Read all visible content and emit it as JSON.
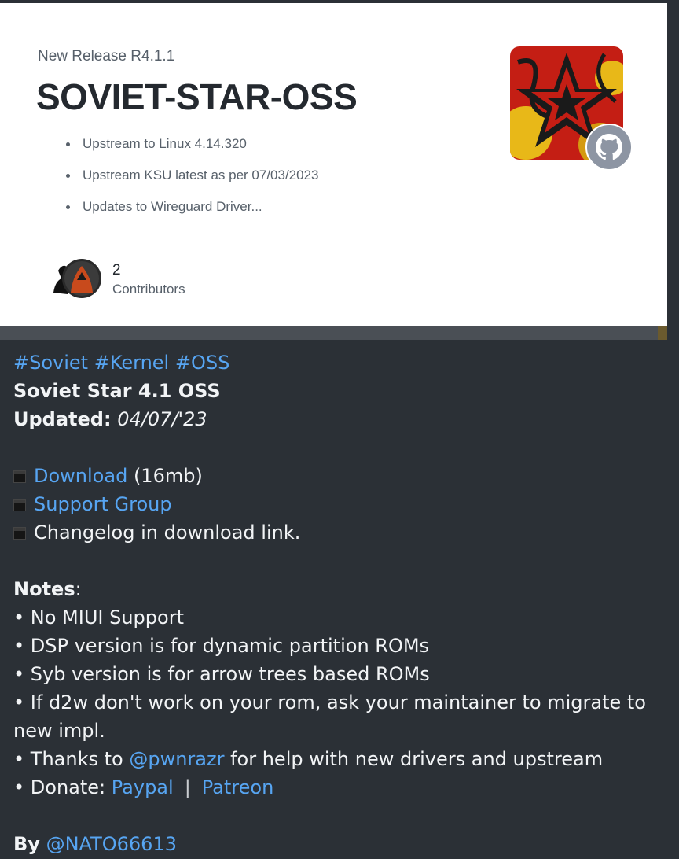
{
  "release_card": {
    "eyebrow": "New Release R4.1.1",
    "repo_name": "SOVIET-STAR-OSS",
    "bullets": [
      "Upstream to Linux 4.14.320",
      "Upstream KSU latest as per 07/03/2023",
      "Updates to Wireguard Driver..."
    ],
    "contributors_count": "2",
    "contributors_label": "Contributors"
  },
  "message": {
    "hashtags": [
      "#Soviet",
      "#Kernel",
      "#OSS"
    ],
    "title": "Soviet Star 4.1 OSS",
    "updated_label": "Updated:",
    "updated_value": "04/07/'23",
    "links": {
      "download_label": "Download",
      "download_size": "(16mb)",
      "support_label": "Support Group",
      "changelog_text": "Changelog in download link."
    },
    "notes_label": "Notes",
    "notes_colon": ":",
    "notes": {
      "n1": "• No MIUI Support",
      "n2": "• DSP version is for dynamic partition ROMs",
      "n3": "• Syb version is for arrow trees based ROMs",
      "n4a": "• If d2w don't work on your rom, ask your maintainer to migrate to",
      "n4b": "new impl.",
      "n5_pre": "• Thanks to ",
      "n5_link": "@pwnrazr",
      "n5_post": " for help with new drivers and upstream",
      "n6_pre": "• Donate: ",
      "n6_paypal": "Paypal",
      "n6_sep": "|",
      "n6_patreon": "Patreon"
    },
    "by_label": "By",
    "by_link": "@NATO66613"
  },
  "colors": {
    "link": "#57a5f2",
    "message_bg": "#2b3036",
    "card_bg": "#ffffff"
  },
  "icons": [
    "github-icon",
    "soviet-star-logo",
    "contributor-avatar",
    "square-bullet-icon"
  ]
}
